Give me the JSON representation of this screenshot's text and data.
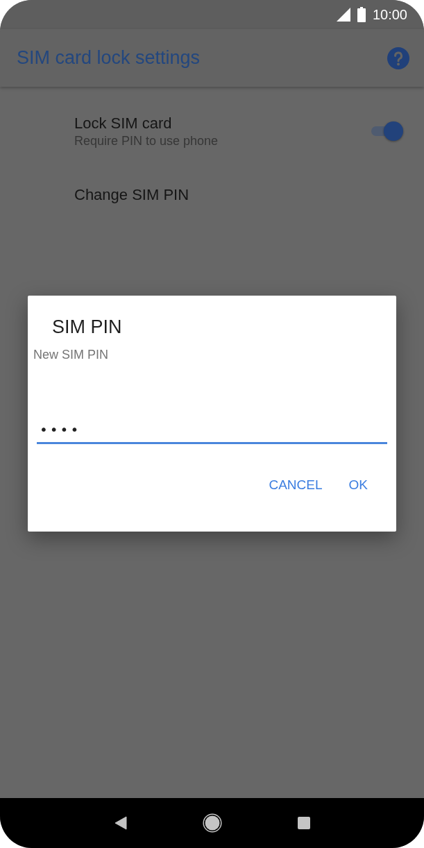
{
  "status_bar": {
    "time": "10:00"
  },
  "app_bar": {
    "title": "SIM card lock settings"
  },
  "settings": [
    {
      "kind": "toggle",
      "title": "Lock SIM card",
      "subtitle": "Require PIN to use phone",
      "on": true
    },
    {
      "kind": "plain",
      "title": "Change SIM PIN"
    }
  ],
  "dialog": {
    "title": "SIM PIN",
    "message": "New SIM PIN",
    "field": {
      "value": "••••",
      "focused": true
    },
    "buttons": [
      "CANCEL",
      "OK"
    ]
  }
}
